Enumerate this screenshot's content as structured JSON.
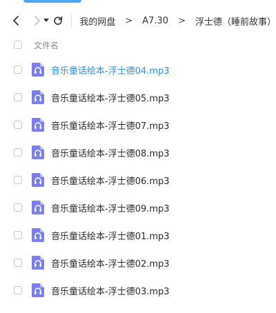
{
  "toolbar": {
    "breadcrumb": [
      "我的网盘",
      "A7.30",
      "浮士德（睡前故事）"
    ],
    "separator": ">"
  },
  "list": {
    "column_header": "文件名",
    "files": [
      {
        "name": "音乐童话绘本-浮士德04.mp3",
        "type_icon": "audio-file-icon",
        "highlighted": true
      },
      {
        "name": "音乐童话绘本-浮士德05.mp3",
        "type_icon": "audio-file-icon",
        "highlighted": false
      },
      {
        "name": "音乐童话绘本-浮士德07.mp3",
        "type_icon": "audio-file-icon",
        "highlighted": false
      },
      {
        "name": "音乐童话绘本-浮士德08.mp3",
        "type_icon": "audio-file-icon",
        "highlighted": false
      },
      {
        "name": "音乐童话绘本-浮士德06.mp3",
        "type_icon": "audio-file-icon",
        "highlighted": false
      },
      {
        "name": "音乐童话绘本-浮士德09.mp3",
        "type_icon": "audio-file-icon",
        "highlighted": false
      },
      {
        "name": "音乐童话绘本-浮士德01.mp3",
        "type_icon": "audio-file-icon",
        "highlighted": false
      },
      {
        "name": "音乐童话绘本-浮士德02.mp3",
        "type_icon": "audio-file-icon",
        "highlighted": false
      },
      {
        "name": "音乐童话绘本-浮士德03.mp3",
        "type_icon": "audio-file-icon",
        "highlighted": false
      }
    ]
  },
  "colors": {
    "accent": "#4ea7f4",
    "highlight_text": "#2f8fdc",
    "audio_icon": "#7b7ef0"
  }
}
